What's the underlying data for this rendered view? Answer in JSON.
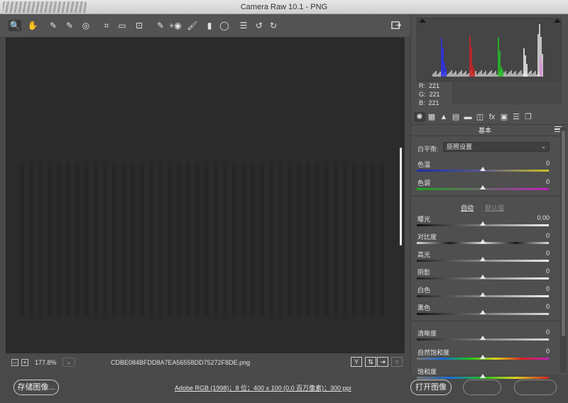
{
  "window": {
    "title": "Camera Raw 10.1 -  PNG"
  },
  "toolbar": {
    "tools": [
      {
        "name": "zoom-tool-icon",
        "glyph": "🔍"
      },
      {
        "name": "hand-tool-icon",
        "glyph": "✋"
      },
      {
        "name": "white-balance-tool-icon",
        "glyph": "✎"
      },
      {
        "name": "color-sampler-tool-icon",
        "glyph": "✎"
      },
      {
        "name": "targeted-adjustment-tool-icon",
        "glyph": "◎"
      },
      {
        "name": "crop-tool-icon",
        "glyph": "⌗"
      },
      {
        "name": "straighten-tool-icon",
        "glyph": "▭"
      },
      {
        "name": "transform-tool-icon",
        "glyph": "⊡"
      },
      {
        "name": "spot-removal-tool-icon",
        "glyph": "✎"
      },
      {
        "name": "red-eye-tool-icon",
        "glyph": "+◉"
      },
      {
        "name": "adjustment-brush-icon",
        "glyph": "🖌"
      },
      {
        "name": "graduated-filter-icon",
        "glyph": "▮"
      },
      {
        "name": "radial-filter-icon",
        "glyph": "◯"
      },
      {
        "name": "preferences-icon",
        "glyph": "☰"
      },
      {
        "name": "rotate-left-icon",
        "glyph": "↺"
      },
      {
        "name": "rotate-right-icon",
        "glyph": "↻"
      }
    ]
  },
  "status": {
    "zoom": "177.8%",
    "zoom_chevron": "⌄",
    "filename": "CDBE084BFDD8A7EA56558DD75272F8DE.png",
    "zoom_out": "–",
    "zoom_in": "+",
    "before_after_y": "Y",
    "swap_icon": "⇅",
    "copy_icon": "⇥",
    "toggle_icon": "≡"
  },
  "bottom": {
    "save_label": "存储图像...",
    "workflow_link": "Adobe RGB (1998)；8 位；400 x 100 (0.0 百万像素)；300 ppi",
    "open_label": "打开图像",
    "cancel_label": "",
    "done_label": ""
  },
  "histogram": {
    "rgb": {
      "r_label": "R:",
      "g_label": "G:",
      "b_label": "B:",
      "r": "221",
      "g": "221",
      "b": "221"
    }
  },
  "panel": {
    "tabs": [
      "basic-tab-icon",
      "tone-curve-tab-icon",
      "detail-tab-icon",
      "hsl-tab-icon",
      "split-toning-tab-icon",
      "lens-corrections-tab-icon",
      "effects-tab-icon",
      "calibration-tab-icon",
      "presets-tab-icon",
      "snapshots-tab-icon"
    ],
    "tab_glyphs": [
      "✺",
      "▦",
      "▲",
      "▤",
      "▬",
      "◫",
      "fx",
      "▣",
      "☰",
      "❐"
    ],
    "section_title": "基本",
    "white_balance": {
      "label": "白平衡:",
      "value": "原照设置",
      "chevron": "⌄"
    },
    "auto_label": "自动",
    "default_label": "默认值",
    "sliders_wb": [
      {
        "label": "色温",
        "value": "0",
        "pos": 0.5,
        "track": "linear-gradient(90deg,#1a2bb0,#5a5a8a 50%,#c9c223)"
      },
      {
        "label": "色调",
        "value": "0",
        "pos": 0.5,
        "track": "linear-gradient(90deg,#1da61d,#6a6a6a 50%,#c21dc2)"
      }
    ],
    "sliders_tone": [
      {
        "label": "曝光",
        "value": "0.00",
        "pos": 0.5,
        "track": "linear-gradient(90deg,#111,#eee)"
      },
      {
        "label": "对比度",
        "value": "0",
        "pos": 0.5,
        "track": "linear-gradient(90deg,#d8d8d8,#1a1a1a 25%,#d8d8d8 50%,#1a1a1a 75%,#d8d8d8)"
      },
      {
        "label": "高光",
        "value": "0",
        "pos": 0.5,
        "track": "linear-gradient(90deg,#222,#eee)"
      },
      {
        "label": "阴影",
        "value": "0",
        "pos": 0.5,
        "track": "linear-gradient(90deg,#222,#eee)"
      },
      {
        "label": "白色",
        "value": "0",
        "pos": 0.5,
        "track": "linear-gradient(90deg,#222,#eee)"
      },
      {
        "label": "黑色",
        "value": "0",
        "pos": 0.5,
        "track": "linear-gradient(90deg,#111,#ddd)"
      }
    ],
    "sliders_presence": [
      {
        "label": "清晰度",
        "value": "0",
        "pos": 0.5,
        "track": "linear-gradient(90deg,#222,#ddd)"
      },
      {
        "label": "自然饱和度",
        "value": "0",
        "pos": 0.5,
        "track": "linear-gradient(90deg,#777,#1a6ad6,#1dc61d,#e0d01d,#d62020,#c21dc2)"
      },
      {
        "label": "饱和度",
        "value": "",
        "pos": 0.5,
        "track": "linear-gradient(90deg,#777,#1a6ad6,#1dc61d,#e0d01d,#d62020)"
      }
    ]
  },
  "colors": {
    "accent_blue": "#1a2bb0",
    "histo_red": "#d82020",
    "histo_green": "#1ecc1e",
    "histo_blue": "#2a2cff"
  }
}
